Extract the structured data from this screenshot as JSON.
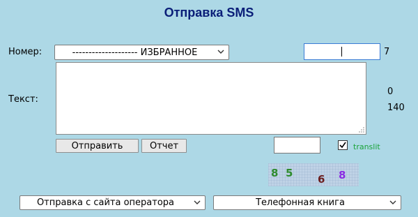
{
  "page": {
    "title": "Отправка SMS"
  },
  "form": {
    "number_label": "Номер:",
    "number_select_value": "-------------------- ИЗБРАННОЕ",
    "text_label": "Текст:",
    "text_value": "",
    "phone_value": "",
    "phone_digits_count": "7",
    "chars_count": "0",
    "chars_remaining": "140",
    "captcha_value": "",
    "translit_label": "translit",
    "translit_checked": true
  },
  "buttons": {
    "send_label": "Отправить",
    "report_label": "Отчет"
  },
  "captcha": {
    "chars": [
      "8",
      "5",
      "6",
      "8"
    ],
    "colors": [
      "#2e8b2e",
      "#2e8b2e",
      "#6b1d1d",
      "#8a2be2"
    ]
  },
  "bottom": {
    "operator_select_value": "Отправка с сайта оператора",
    "phonebook_select_value": "Телефонная книга"
  },
  "colors": {
    "background": "#add8e6",
    "title": "#0a1e78",
    "translit": "#1aa33a",
    "focus_border": "#3a7bd5"
  },
  "icons": {
    "dropdown": "chevron-down-icon",
    "checkbox": "check-icon",
    "resize": "resize-grip-icon"
  }
}
